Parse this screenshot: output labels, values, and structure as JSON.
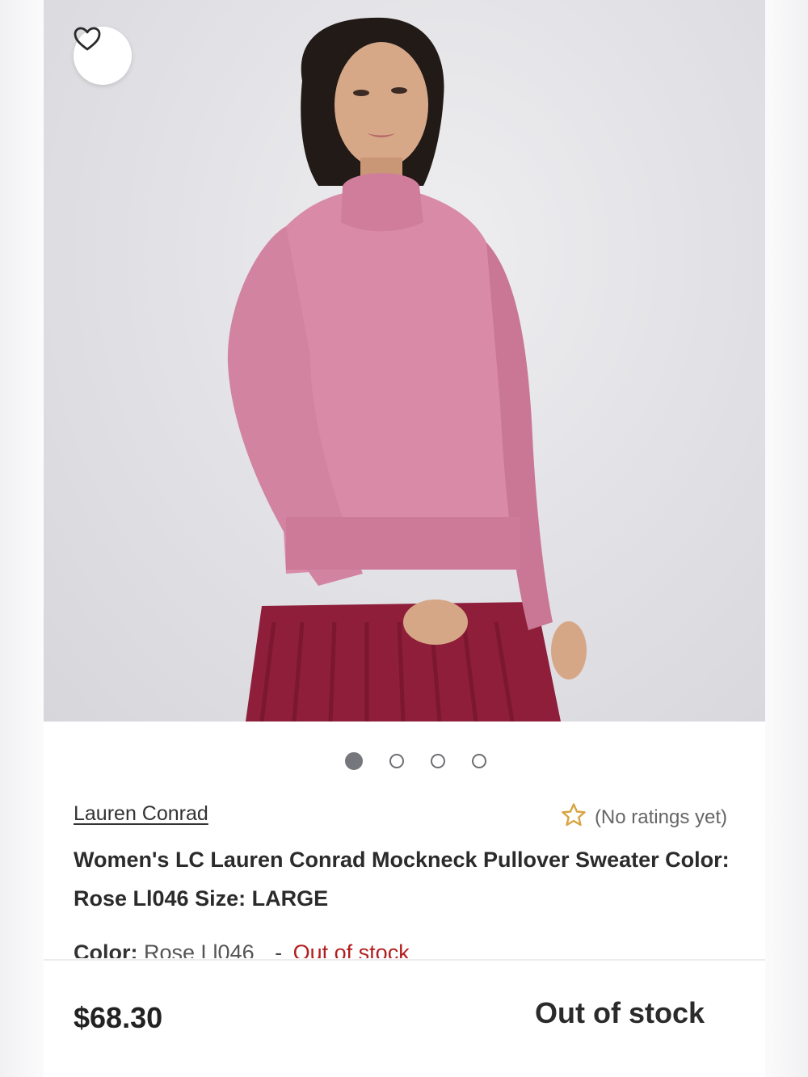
{
  "product": {
    "brand": "Lauren Conrad",
    "rating_text": "(No ratings yet)",
    "title": "Women's LC Lauren Conrad Mockneck Pullover Sweater Color: Rose Ll046 Size: LARGE",
    "color_label": "Color:",
    "color_value": "Rose Ll046",
    "color_separator": "-",
    "color_status": "Out of stock",
    "price": "$68.30",
    "availability": "Out of stock"
  },
  "carousel": {
    "total_images": 4,
    "active_index": 0
  },
  "icons": {
    "favorite": "heart-outline-icon",
    "rating": "star-outline-icon"
  },
  "colors": {
    "sweater": "#d88aa6",
    "skirt": "#8e1e3a",
    "star": "#d9a441",
    "out_of_stock": "#b21e1e",
    "dot_active": "#76767d"
  }
}
